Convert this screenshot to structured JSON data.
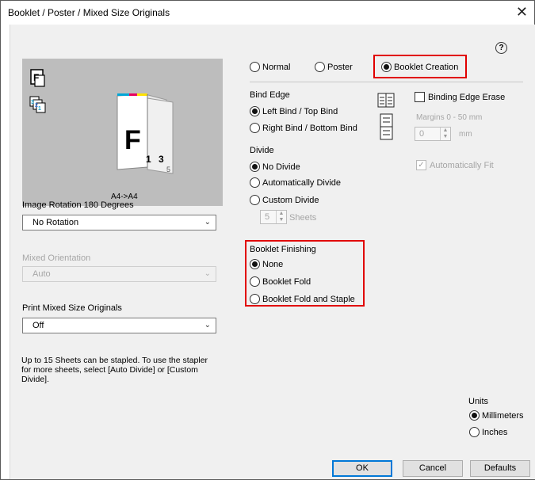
{
  "window": {
    "title": "Booklet / Poster / Mixed Size Originals",
    "close_glyph": "✕",
    "help_glyph": "?"
  },
  "preview": {
    "caption": "A4->A4",
    "page_letter": "F",
    "page_numbers": [
      "1",
      "3",
      "5"
    ],
    "icon_letter": "F",
    "stack_numbers": [
      "3",
      "2",
      "1"
    ]
  },
  "image_rotation": {
    "label": "Image Rotation 180 Degrees",
    "value": "No Rotation"
  },
  "mixed_orientation": {
    "label": "Mixed Orientation",
    "value": "Auto"
  },
  "print_mixed": {
    "label": "Print Mixed Size Originals",
    "value": "Off"
  },
  "note": "Up to 15 Sheets can be stapled. To use the stapler for more sheets, select [Auto Divide] or [Custom Divide].",
  "mode": {
    "options": [
      "Normal",
      "Poster",
      "Booklet Creation"
    ],
    "selected": "Booklet Creation"
  },
  "bind_edge": {
    "label": "Bind Edge",
    "options": [
      "Left Bind / Top Bind",
      "Right Bind / Bottom Bind"
    ],
    "selected": "Left Bind / Top Bind"
  },
  "binding_edge_erase": {
    "label": "Binding Edge Erase",
    "checked": false,
    "margins_label": "Margins 0 - 50 mm",
    "margins_value": "0",
    "unit": "mm"
  },
  "auto_fit": {
    "label": "Automatically Fit",
    "checked": true
  },
  "divide": {
    "label": "Divide",
    "options": [
      "No Divide",
      "Automatically Divide",
      "Custom Divide"
    ],
    "selected": "No Divide",
    "sheets_value": "5",
    "sheets_label": "Sheets"
  },
  "booklet_finishing": {
    "label": "Booklet Finishing",
    "options": [
      "None",
      "Booklet Fold",
      "Booklet Fold and Staple"
    ],
    "selected": "None"
  },
  "units": {
    "label": "Units",
    "options": [
      "Millimeters",
      "Inches"
    ],
    "selected": "Millimeters"
  },
  "buttons": {
    "ok": "OK",
    "cancel": "Cancel",
    "defaults": "Defaults"
  },
  "colors": {
    "highlight": "#e10000",
    "panel": "#f0f0f0",
    "preview_bg": "#bdbdbd",
    "disabled_text": "#a6a6a6"
  }
}
